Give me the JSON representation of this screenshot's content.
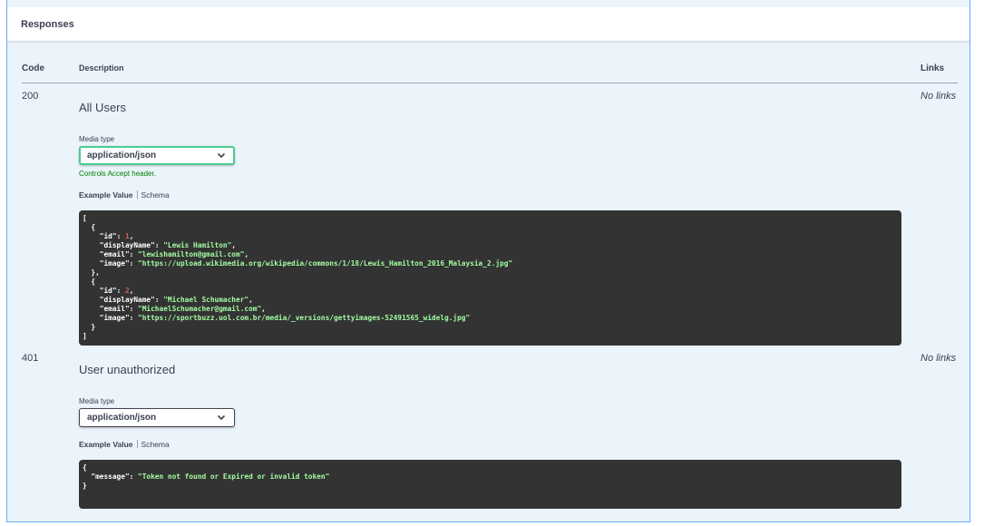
{
  "section": {
    "title": "Responses"
  },
  "table_headers": {
    "code": "Code",
    "description": "Description",
    "links": "Links"
  },
  "responses": [
    {
      "code": "200",
      "description": "All Users",
      "links": "No links",
      "media_type_label": "Media type",
      "media_type": "application/json",
      "accept_note": "Controls Accept header.",
      "example_tab": "Example Value",
      "schema_tab": "Schema",
      "example": {
        "open": "[",
        "close": "]",
        "items": [
          {
            "id": "1",
            "displayName": "\"Lewis Hamilton\"",
            "email": "\"lewishamilton@gmail.com\"",
            "image": "\"https://upload.wikimedia.org/wikipedia/commons/1/18/Lewis_Hamilton_2016_Malaysia_2.jpg\""
          },
          {
            "id": "2",
            "displayName": "\"Michael Schumacher\"",
            "email": "\"MichaelSchumacher@gmail.com\"",
            "image": "\"https://sportbuzz.uol.com.br/media/_versions/gettyimages-52491565_widelg.jpg\""
          }
        ]
      }
    },
    {
      "code": "401",
      "description": "User unauthorized",
      "links": "No links",
      "media_type_label": "Media type",
      "media_type": "application/json",
      "example_tab": "Example Value",
      "schema_tab": "Schema",
      "example": {
        "open": "{",
        "close": "}",
        "message_key": "\"message\"",
        "message_value": "\"Token not found or Expired or invalid token\""
      }
    }
  ],
  "json_keys": {
    "id": "\"id\"",
    "displayName": "\"displayName\"",
    "email": "\"email\"",
    "image": "\"image\""
  },
  "colors": {
    "accent": "#61affe",
    "panel_bg": "#ebf3fb",
    "select_ok": "#49cc90",
    "code_bg": "#333333",
    "string": "#a2fca2",
    "number": "#d36363"
  }
}
